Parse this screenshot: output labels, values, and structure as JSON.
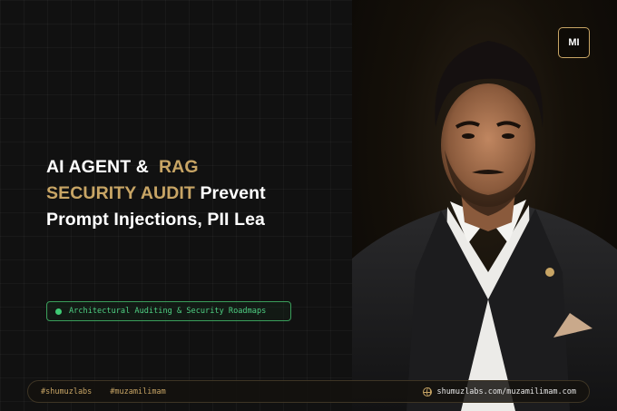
{
  "headline": {
    "line1_white": "AI AGENT &",
    "line1_gold": "RAG",
    "line2_gold": "SECURITY AUDIT",
    "line2_white": "Prevent",
    "line3_white": "Prompt Injections, PII Lea"
  },
  "tag": {
    "label": "Architectural Auditing & Security Roadmaps"
  },
  "badge": {
    "initials": "MI"
  },
  "footer": {
    "handle1": "#shumuzlabs",
    "handle2": "#muzamilimam",
    "site1": "shumuzlabs.com",
    "separator": "/",
    "site2": "muzamilimam.com"
  },
  "colors": {
    "gold": "#c8a565",
    "green": "#3ecb74",
    "background": "#111111"
  },
  "icons": [
    "globe-icon",
    "status-dot-icon",
    "pocket-square",
    "lapel-pin"
  ]
}
